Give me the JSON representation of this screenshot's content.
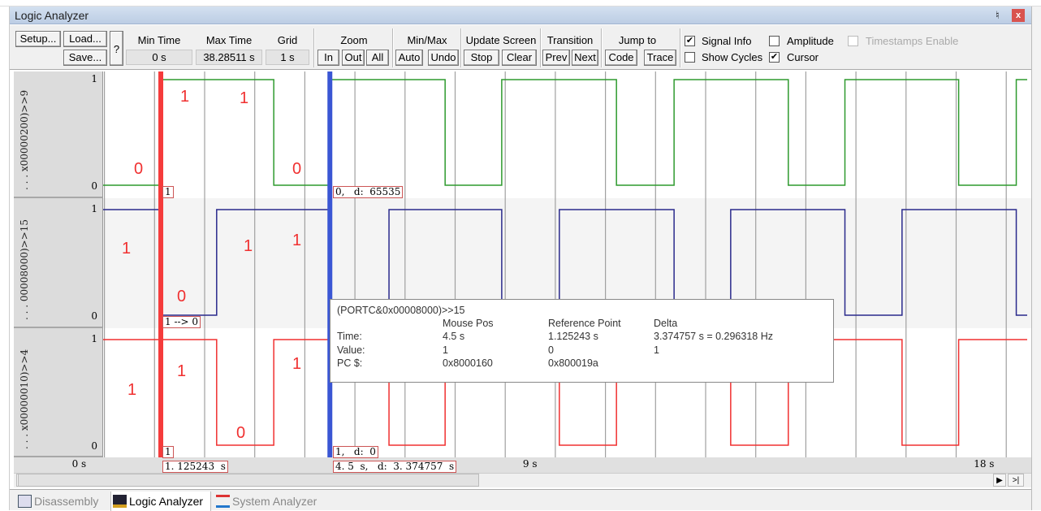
{
  "window": {
    "title": "Logic Analyzer",
    "pin_icon": "pin-icon",
    "close_label": "x"
  },
  "toolbar": {
    "setup": "Setup...",
    "load": "Load...",
    "save": "Save...",
    "help": "?",
    "min_time_label": "Min Time",
    "min_time": "0 s",
    "max_time_label": "Max Time",
    "max_time": "38.28511 s",
    "grid_label": "Grid",
    "grid": "1 s",
    "zoom_label": "Zoom",
    "zoom_in": "In",
    "zoom_out": "Out",
    "zoom_all": "All",
    "minmax_label": "Min/Max",
    "auto": "Auto",
    "undo": "Undo",
    "update_label": "Update Screen",
    "stop": "Stop",
    "clear": "Clear",
    "transition_label": "Transition",
    "prev": "Prev",
    "next": "Next",
    "jump_label": "Jump to",
    "code": "Code",
    "trace": "Trace",
    "checkboxes": [
      {
        "label": "Signal Info",
        "checked": true,
        "enabled": true
      },
      {
        "label": "Amplitude",
        "checked": false,
        "enabled": true
      },
      {
        "label": "Timestamps Enable",
        "checked": false,
        "enabled": false
      },
      {
        "label": "Show Cycles",
        "checked": false,
        "enabled": true
      },
      {
        "label": "Cursor",
        "checked": true,
        "enabled": true
      }
    ]
  },
  "signals": [
    {
      "name": ". . . x00000200)>>9",
      "high": "1",
      "low": "0",
      "color": "#2e9a2e",
      "initial": 0,
      "transitions": [
        1.125,
        3.38,
        4.5,
        6.8,
        7.93,
        10.22,
        11.37,
        13.65,
        14.78,
        17.05,
        18.2
      ]
    },
    {
      "name": ". . . 00008000)>>15",
      "high": "1",
      "low": "0",
      "color": "#2a2a8c",
      "initial": 1,
      "transitions": [
        1.125,
        2.24,
        4.5,
        5.68,
        7.93,
        9.08,
        11.37,
        12.5,
        14.78,
        15.92,
        18.2
      ]
    },
    {
      "name": ". . . x00000010)>>4",
      "high": "1",
      "low": "0",
      "color": "#f03030",
      "initial": 1,
      "transitions": [
        2.24,
        3.38,
        5.68,
        6.8,
        9.08,
        10.22,
        12.5,
        13.65,
        15.92,
        17.05
      ]
    }
  ],
  "time_axis": {
    "view_start_s": 0,
    "view_end_s": 18.42,
    "grid_s": 1,
    "labels": [
      "0 s",
      "9 s",
      "18 s"
    ],
    "label_values": [
      0,
      9,
      18
    ]
  },
  "cursors": {
    "reference": {
      "time_s": 1.125243,
      "color": "#f53b3b",
      "label": "1. 125243  s",
      "values": [
        "1",
        "1 --> 0",
        "1"
      ]
    },
    "mouse": {
      "time_s": 4.5,
      "color": "#3a56d4",
      "label": "4. 5  s,   d:  3. 374757  s",
      "values": [
        "0,   d:  65535",
        "",
        "1,   d:  0"
      ]
    }
  },
  "tooltip": {
    "signal": "(PORTC&0x00008000)>>15",
    "headers": [
      "Mouse Pos",
      "Reference Point",
      "Delta"
    ],
    "rows": [
      {
        "label": "Time:",
        "mouse": "4.5 s",
        "ref": "1.125243 s",
        "delta": "3.374757 s = 0.296318 Hz"
      },
      {
        "label": "Value:",
        "mouse": "1",
        "ref": "0",
        "delta": "1"
      },
      {
        "label": "PC $:",
        "mouse": "0x8000160",
        "ref": "0x800019a",
        "delta": ""
      }
    ]
  },
  "annotations": [
    "0",
    "1",
    "1",
    "0",
    "1",
    "0",
    "1",
    "1",
    "1",
    "1",
    "0",
    "1"
  ],
  "tabs": [
    {
      "label": "Disassembly",
      "active": false
    },
    {
      "label": "Logic Analyzer",
      "active": true
    },
    {
      "label": "System Analyzer",
      "active": false
    }
  ],
  "scroll": {
    "left_arrow": "◀",
    "right_arrow": "▶",
    "end": ">|"
  }
}
